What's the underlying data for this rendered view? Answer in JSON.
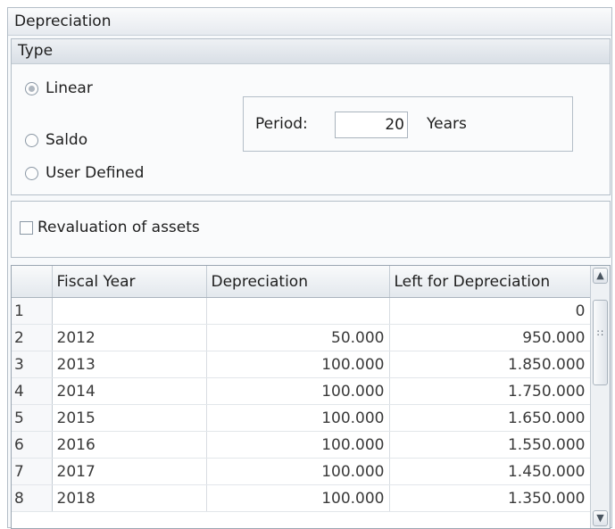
{
  "panel": {
    "title": "Depreciation"
  },
  "type_group": {
    "title": "Type",
    "options": [
      {
        "label": "Linear",
        "checked": true
      },
      {
        "label": "Saldo",
        "checked": false
      },
      {
        "label": "User Defined",
        "checked": false
      }
    ],
    "period": {
      "label": "Period:",
      "value": "20",
      "unit": "Years"
    }
  },
  "revaluation": {
    "label": "Revaluation of assets",
    "checked": false
  },
  "grid": {
    "columns": [
      "",
      "Fiscal Year",
      "Depreciation",
      "Left for Depreciation"
    ],
    "rows": [
      {
        "num": "1",
        "year": "",
        "depreciation": "",
        "left": "0"
      },
      {
        "num": "2",
        "year": "2012",
        "depreciation": "50.000",
        "left": "950.000"
      },
      {
        "num": "3",
        "year": "2013",
        "depreciation": "100.000",
        "left": "1.850.000"
      },
      {
        "num": "4",
        "year": "2014",
        "depreciation": "100.000",
        "left": "1.750.000"
      },
      {
        "num": "5",
        "year": "2015",
        "depreciation": "100.000",
        "left": "1.650.000"
      },
      {
        "num": "6",
        "year": "2016",
        "depreciation": "100.000",
        "left": "1.550.000"
      },
      {
        "num": "7",
        "year": "2017",
        "depreciation": "100.000",
        "left": "1.450.000"
      },
      {
        "num": "8",
        "year": "2018",
        "depreciation": "100.000",
        "left": "1.350.000"
      }
    ],
    "scrollbar": {
      "up_icon": "chevron-up-icon",
      "down_icon": "chevron-down-icon",
      "grip_icon": "grip-icon"
    }
  }
}
